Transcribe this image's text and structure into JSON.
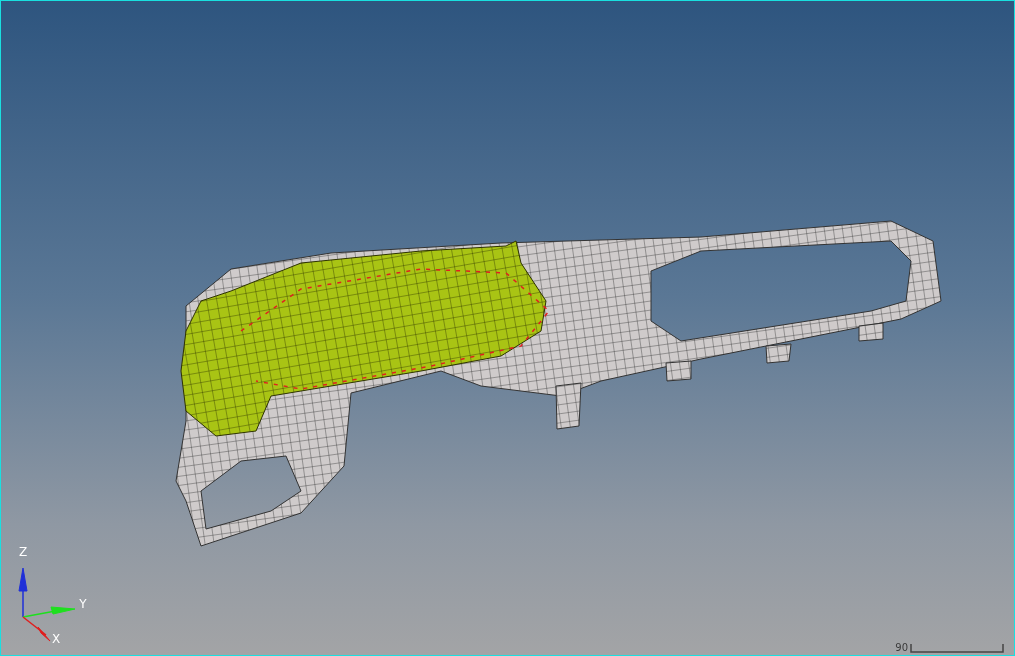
{
  "viewport": {
    "axes": [
      {
        "label": "Z",
        "color": "#1f2fd8"
      },
      {
        "label": "Y",
        "color": "#1ee01e"
      },
      {
        "label": "X",
        "color": "#e01e1e"
      }
    ],
    "scale_bar": {
      "label": "90"
    }
  }
}
